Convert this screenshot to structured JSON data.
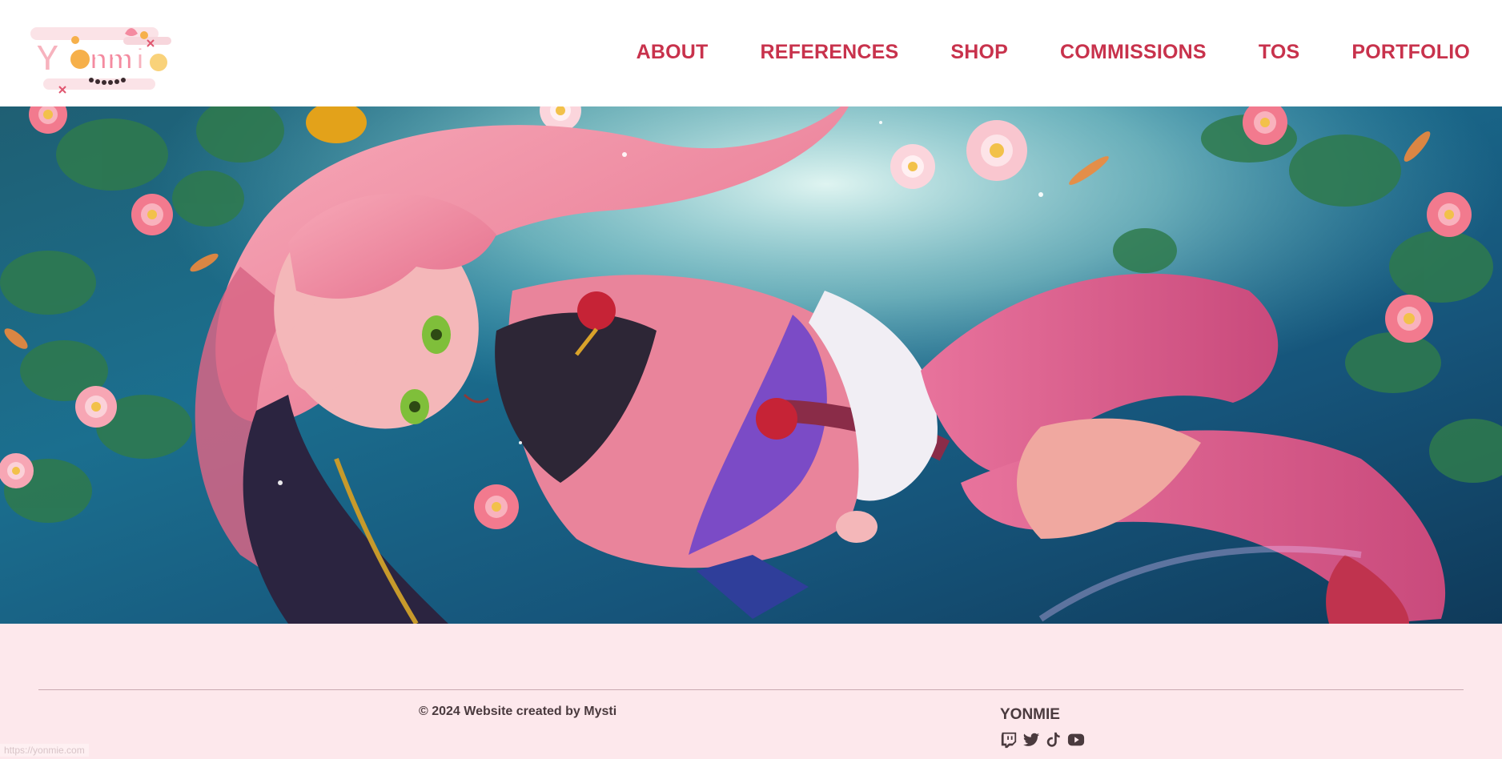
{
  "header": {
    "logo_alt": "Yonmie",
    "nav": [
      {
        "label": "ABOUT"
      },
      {
        "label": "REFERENCES"
      },
      {
        "label": "SHOP"
      },
      {
        "label": "COMMISSIONS"
      },
      {
        "label": "TOS"
      },
      {
        "label": "PORTFOLIO"
      }
    ]
  },
  "footer": {
    "copyright": "© 2024 Website created by Mysti",
    "brand": "YONMIE",
    "socials": [
      {
        "icon": "twitch-icon"
      },
      {
        "icon": "twitter-icon"
      },
      {
        "icon": "tiktok-icon"
      },
      {
        "icon": "youtube-icon"
      }
    ],
    "status_url": "https://yonmie.com"
  },
  "colors": {
    "accent": "#c8324c",
    "footer_bg": "#fde8ec",
    "footer_text": "#4a3a3e"
  }
}
